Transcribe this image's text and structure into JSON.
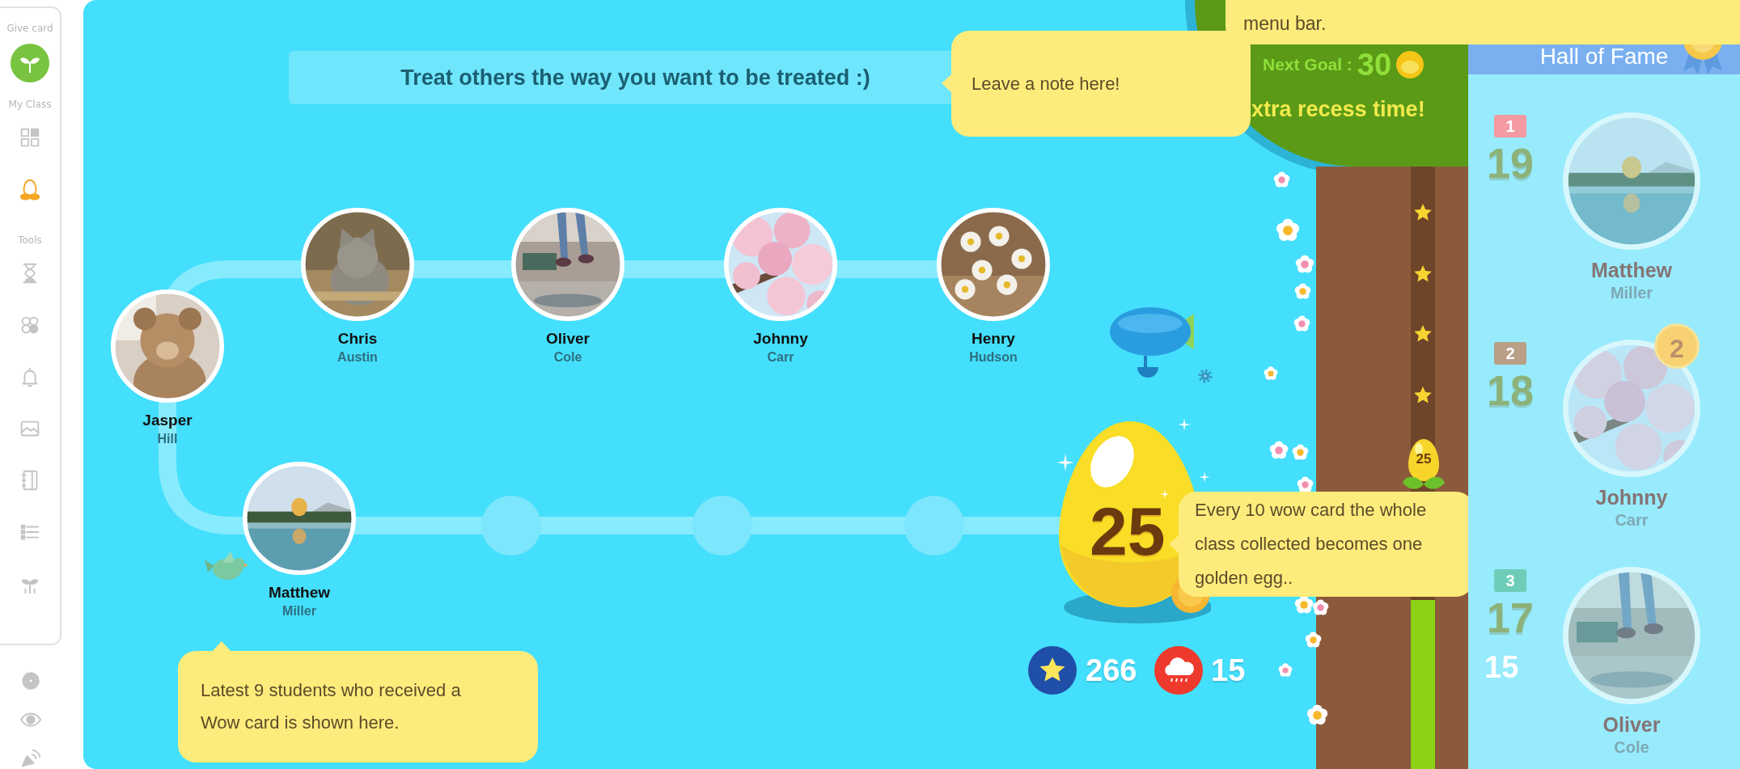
{
  "sidebar": {
    "give_card_label": "Give card",
    "my_class_label": "My Class",
    "my_class": [
      {
        "selected": false
      },
      {
        "selected": true
      }
    ],
    "tools_label": "Tools",
    "tools": [
      {
        "selected": false
      },
      {
        "selected": false
      },
      {
        "selected": false
      },
      {
        "selected": false
      },
      {
        "selected": false
      },
      {
        "selected": false
      },
      {
        "selected": false
      }
    ]
  },
  "motto": "Treat others the way you want to be treated :)",
  "note_tip": "Leave a note here!",
  "menu_tip": "menu bar.",
  "goal": {
    "label": "Next Goal :",
    "value": "30",
    "reward": "xtra recess time!"
  },
  "tree": {
    "egg_label": "25",
    "level": 0.28
  },
  "students": [
    {
      "first": "Jasper",
      "last": "Hill"
    },
    {
      "first": "Chris",
      "last": "Austin"
    },
    {
      "first": "Oliver",
      "last": "Cole"
    },
    {
      "first": "Johnny",
      "last": "Carr"
    },
    {
      "first": "Henry",
      "last": "Hudson"
    },
    {
      "first": "Matthew",
      "last": "Miller"
    }
  ],
  "egg": {
    "count": "25"
  },
  "egg_tip": "Every 10 wow card the whole class collected becomes one golden egg..",
  "counters": [
    {
      "kind": "star",
      "value": "266"
    },
    {
      "kind": "rain",
      "value": "15"
    }
  ],
  "students_tip": "Latest 9 students who received a Wow card is shown here.",
  "hall_of_fame": {
    "title": "Hall of Fame",
    "entries": [
      {
        "rank": "1",
        "color": "#f49aa2",
        "score": "19",
        "first": "Matthew",
        "last": "Miller"
      },
      {
        "rank": "2",
        "color": "#b89f86",
        "score": "18",
        "first": "Johnny",
        "last": "Carr",
        "medal": "2"
      },
      {
        "rank": "3",
        "color": "#6dcdb8",
        "score": "17",
        "first": "Oliver",
        "last": "Cole"
      }
    ],
    "counter": "15"
  }
}
